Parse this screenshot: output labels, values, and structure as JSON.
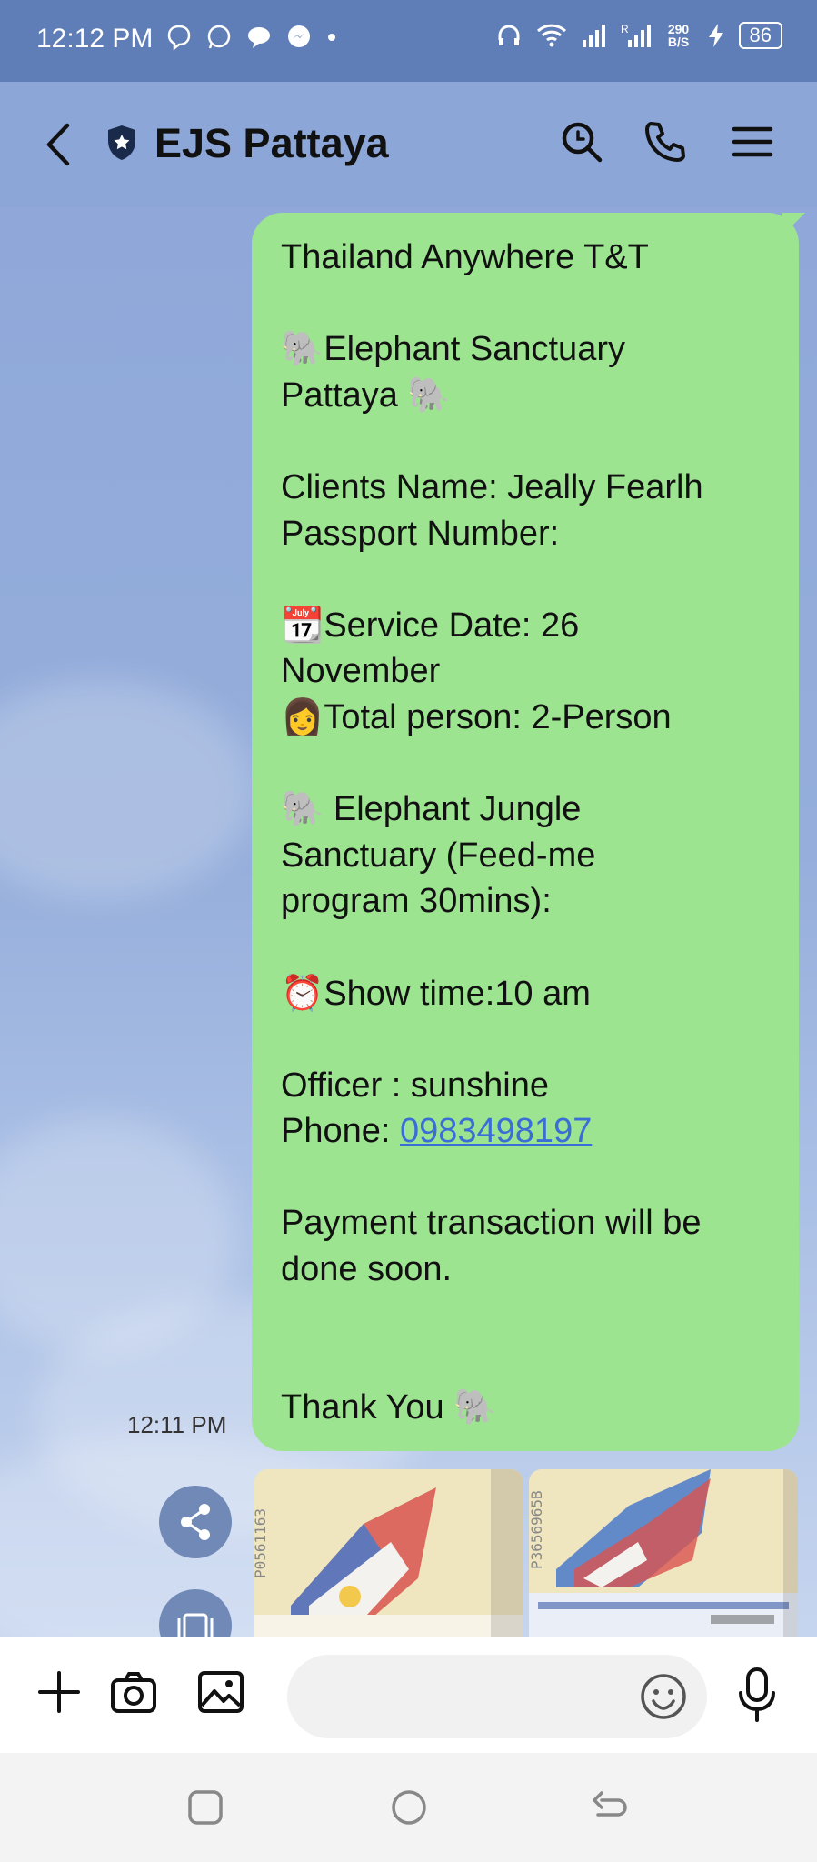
{
  "status_bar": {
    "time": "12:12 PM",
    "net_speed": "290 B/S",
    "battery": "86"
  },
  "header": {
    "title": "EJS Pattaya"
  },
  "message": {
    "lines": [
      "Thailand Anywhere T&T",
      "",
      "🐘Elephant Sanctuary",
      "Pattaya 🐘",
      "",
      "Clients Name: Jeally Fearlh",
      "Passport Number:",
      "",
      "📆Service Date: 26",
      "November",
      "👩Total person: 2-Person",
      "",
      "🐘 Elephant Jungle",
      "Sanctuary (Feed-me",
      "program 30mins):",
      "",
      "⏰Show time:10 am",
      "",
      "Officer : sunshine",
      "Phone: ",
      "",
      "Payment transaction will be",
      "done soon.",
      "",
      "",
      "Thank You 🐘"
    ],
    "phone_link": "0983498197",
    "timestamp": "12:11 PM"
  },
  "input": {
    "placeholder": ""
  },
  "icons": {
    "back": "chevron-left-icon",
    "shield": "shield-star-icon",
    "search": "search-icon",
    "phone": "phone-icon",
    "menu": "hamburger-menu-icon",
    "share": "share-icon",
    "plus": "plus-icon",
    "camera": "camera-icon",
    "image": "image-icon",
    "emoji": "smiley-icon",
    "mic": "microphone-icon"
  },
  "colors": {
    "bubble": "#9de491",
    "background": "#8ca6d8",
    "status_bar": "#5f7db6",
    "link": "#3a6ed6"
  }
}
